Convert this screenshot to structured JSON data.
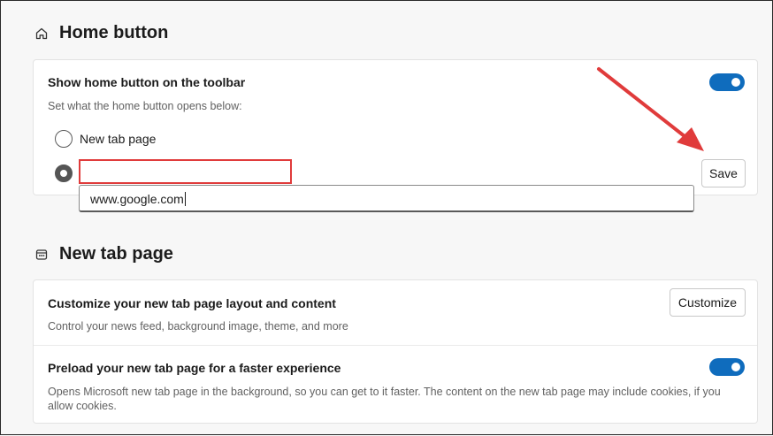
{
  "home_section": {
    "title": "Home button",
    "icon": "home-icon",
    "show_toggle_title": "Show home button on the toolbar",
    "show_toggle_sub": "Set what the home button opens below:",
    "toggle_on": true,
    "option_new_tab": "New tab page",
    "url_value": "www.google.com",
    "save_label": "Save"
  },
  "newtab_section": {
    "title": "New tab page",
    "icon": "new-tab-page-icon",
    "customize_title": "Customize your new tab page layout and content",
    "customize_sub": "Control your news feed, background image, theme, and more",
    "customize_label": "Customize",
    "preload_title": "Preload your new tab page for a faster experience",
    "preload_sub": "Opens Microsoft new tab page in the background, so you can get to it faster. The content on the new tab page may include cookies, if you allow cookies.",
    "preload_toggle_on": true
  },
  "colors": {
    "accent": "#0f6cbd",
    "annotation": "#e03b3b"
  }
}
